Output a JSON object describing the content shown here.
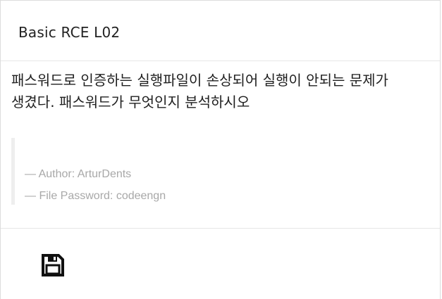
{
  "card": {
    "title": "Basic RCE L02",
    "description": "패스워드로 인증하는 실행파일이 손상되어 실행이 안되는 문제가 생겼다. 패스워드가 무엇인지 분석하시오",
    "meta": [
      "— Author: ArturDents",
      "— File Password: codeengn"
    ],
    "footer": {
      "icon": "save-icon"
    }
  }
}
